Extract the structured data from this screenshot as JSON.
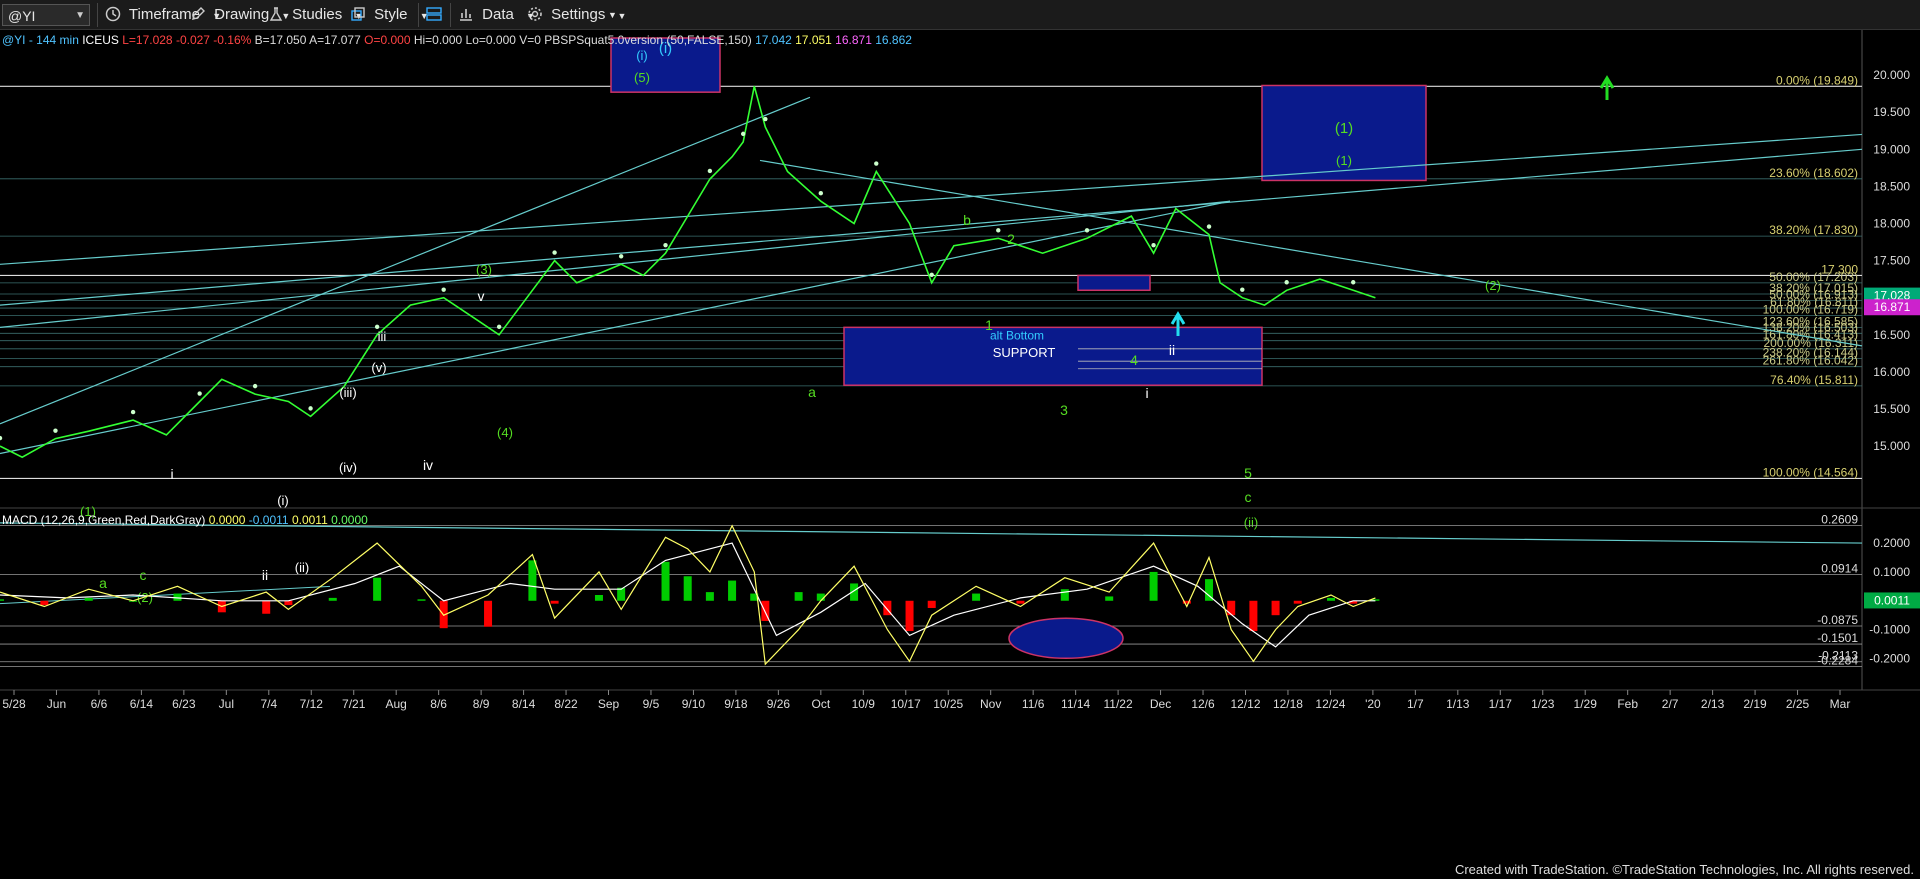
{
  "toolbar": {
    "symbol": "@YI",
    "timeframe": "Timeframe",
    "drawing": "Drawing",
    "studies": "Studies",
    "style": "Style",
    "data": "Data",
    "settings": "Settings"
  },
  "header_line": {
    "parts": [
      {
        "text": "@YI - 144 min",
        "color": "#4fc3ff"
      },
      {
        "text": "ICEUS",
        "color": "#ffffff"
      },
      {
        "text": "L=17.028",
        "color": "#ff4444"
      },
      {
        "text": "-0.027",
        "color": "#ff4444"
      },
      {
        "text": "-0.16%",
        "color": "#ff4444"
      },
      {
        "text": "B=17.050",
        "color": "#dddddd"
      },
      {
        "text": "A=17.077",
        "color": "#dddddd"
      },
      {
        "text": "O=0.000",
        "color": "#ff4444"
      },
      {
        "text": "Hi=0.000",
        "color": "#dddddd"
      },
      {
        "text": "Lo=0.000",
        "color": "#dddddd"
      },
      {
        "text": "V=0",
        "color": "#dddddd"
      },
      {
        "text": "PBSPSquat5.0version (50,FALSE,150)",
        "color": "#dddddd"
      },
      {
        "text": "17.042",
        "color": "#4fc3ff"
      },
      {
        "text": "17.051",
        "color": "#ffff66"
      },
      {
        "text": "16.871",
        "color": "#ff66ff"
      },
      {
        "text": "16.862",
        "color": "#4fc3ff"
      }
    ]
  },
  "macd_header": {
    "parts": [
      {
        "text": "MACD (12,26,9,Green,Red,DarkGray)",
        "color": "#ffffff"
      },
      {
        "text": "0.0000",
        "color": "#ffff66"
      },
      {
        "text": "-0.0011",
        "color": "#4fc3ff"
      },
      {
        "text": "0.0011",
        "color": "#ffff66"
      },
      {
        "text": "0.0000",
        "color": "#66ff66"
      }
    ]
  },
  "footer": "Created with TradeStation. ©TradeStation Technologies, Inc. All rights reserved.",
  "colors": {
    "background": "#000000",
    "price": "#33ff33",
    "trendline": "#66cccc",
    "box_fill": "#0a1a8c",
    "box_border": "#cc3366",
    "label_green": "#55dd22",
    "label_white": "#ffffff",
    "label_cyan": "#33ccff",
    "macd_fast": "#ffff66",
    "macd_slow": "#ffffff",
    "hist_up": "#00cc00",
    "hist_down": "#ff0000"
  },
  "chart_data": [
    {
      "type": "line",
      "title": "@YI - 144 min",
      "y_axis_ticks": [
        "20.000",
        "19.500",
        "19.000",
        "18.500",
        "18.000",
        "17.500",
        "17.000",
        "16.500",
        "16.000",
        "15.500",
        "15.000"
      ],
      "ylim": [
        14.3,
        20.5
      ],
      "x_axis_labels": [
        "5/28",
        "Jun",
        "6/6",
        "6/14",
        "6/23",
        "Jul",
        "7/4",
        "7/12",
        "7/21",
        "Aug",
        "8/6",
        "8/9",
        "8/14",
        "8/22",
        "Sep",
        "9/5",
        "9/10",
        "9/18",
        "9/26",
        "Oct",
        "10/9",
        "10/17",
        "10/25",
        "Nov",
        "11/6",
        "11/14",
        "11/22",
        "Dec",
        "12/6",
        "12/12",
        "12/18",
        "12/24",
        "'20",
        "1/7",
        "1/13",
        "1/17",
        "1/23",
        "1/29",
        "Feb",
        "2/7",
        "2/13",
        "2/19",
        "2/25",
        "Mar"
      ],
      "price_badges": [
        {
          "value": "17.028",
          "color": "#00aa77"
        },
        {
          "value": "16.871",
          "color": "#cc22cc"
        }
      ],
      "fib_levels": [
        {
          "label": "0.00% (19.849)",
          "value": 19.849
        },
        {
          "label": "23.60% (18.602)",
          "value": 18.602
        },
        {
          "label": "38.20% (17.830)",
          "value": 17.83
        },
        {
          "label": "17.300",
          "value": 17.3
        },
        {
          "label": "50.00% (17.203)",
          "value": 17.2
        },
        {
          "label": "38.20% (17.015)",
          "value": 17.05
        },
        {
          "label": "50.00% (16.913)",
          "value": 16.96
        },
        {
          "label": "61.80% (16.811)",
          "value": 16.86
        },
        {
          "label": "100.00% (16.719)",
          "value": 16.76
        },
        {
          "label": "123.60% (16.585)",
          "value": 16.6
        },
        {
          "label": "138.20% (16.503)",
          "value": 16.52
        },
        {
          "label": "161.80% (16.413)",
          "value": 16.42
        },
        {
          "label": "200.00% (16.311)",
          "value": 16.311
        },
        {
          "label": "238.20% (16.144)",
          "value": 16.18
        },
        {
          "label": "261.80% (16.042)",
          "value": 16.07
        },
        {
          "label": "76.40% (15.811)",
          "value": 15.811
        },
        {
          "label": "100.00% (14.564)",
          "value": 14.564
        }
      ],
      "boxes": [
        {
          "label": "(i)",
          "x0": 0.47,
          "x1": 0.53,
          "y0": 20.5,
          "y1": 19.77
        },
        {
          "label": "(1)",
          "x0": 1.0,
          "x1": 1.32,
          "y0": 19.86,
          "y1": 18.58
        },
        {
          "label": "alt Bottom",
          "x0": 0.68,
          "x1": 1.0,
          "y0": 16.6,
          "y1": 15.82
        },
        {
          "label": "",
          "x0": 0.83,
          "x1": 0.9,
          "y0": 17.3,
          "y1": 17.1
        }
      ],
      "box_labels": [
        "SUPPORT"
      ],
      "wave_labels": [
        {
          "text": "(1)",
          "color": "#55dd22"
        },
        {
          "text": "a",
          "color": "#55dd22"
        },
        {
          "text": "c",
          "color": "#55dd22"
        },
        {
          "text": "(2)",
          "color": "#55dd22"
        },
        {
          "text": "i",
          "color": "#ffffff"
        },
        {
          "text": "ii",
          "color": "#ffffff"
        },
        {
          "text": "(i)",
          "color": "#ffffff"
        },
        {
          "text": "(ii)",
          "color": "#ffffff"
        },
        {
          "text": "(iii)",
          "color": "#ffffff"
        },
        {
          "text": "(iv)",
          "color": "#ffffff"
        },
        {
          "text": "(v)",
          "color": "#ffffff"
        },
        {
          "text": "iii",
          "color": "#ffffff"
        },
        {
          "text": "iv",
          "color": "#ffffff"
        },
        {
          "text": "v",
          "color": "#ffffff"
        },
        {
          "text": "(3)",
          "color": "#55dd22"
        },
        {
          "text": "(4)",
          "color": "#55dd22"
        },
        {
          "text": "(5)",
          "color": "#55dd22"
        },
        {
          "text": "(i)",
          "color": "#33ccff"
        },
        {
          "text": "a",
          "color": "#55dd22"
        },
        {
          "text": "b",
          "color": "#55dd22"
        },
        {
          "text": "1",
          "color": "#55dd22"
        },
        {
          "text": "2",
          "color": "#55dd22"
        },
        {
          "text": "3",
          "color": "#55dd22"
        },
        {
          "text": "4",
          "color": "#55dd22"
        },
        {
          "text": "5",
          "color": "#55dd22"
        },
        {
          "text": "i",
          "color": "#ffffff"
        },
        {
          "text": "ii",
          "color": "#ffffff"
        },
        {
          "text": "c",
          "color": "#55dd22"
        },
        {
          "text": "(ii)",
          "color": "#55dd22"
        },
        {
          "text": "(1)",
          "color": "#55dd22"
        },
        {
          "text": "(2)",
          "color": "#55dd22"
        }
      ],
      "price_path": [
        [
          0,
          15.0
        ],
        [
          0.01,
          14.85
        ],
        [
          0.025,
          15.1
        ],
        [
          0.04,
          15.2
        ],
        [
          0.06,
          15.35
        ],
        [
          0.075,
          15.15
        ],
        [
          0.09,
          15.6
        ],
        [
          0.1,
          15.9
        ],
        [
          0.115,
          15.7
        ],
        [
          0.13,
          15.6
        ],
        [
          0.14,
          15.4
        ],
        [
          0.155,
          15.8
        ],
        [
          0.17,
          16.5
        ],
        [
          0.185,
          16.9
        ],
        [
          0.2,
          17.0
        ],
        [
          0.215,
          16.7
        ],
        [
          0.225,
          16.5
        ],
        [
          0.24,
          17.1
        ],
        [
          0.25,
          17.5
        ],
        [
          0.26,
          17.2
        ],
        [
          0.28,
          17.45
        ],
        [
          0.29,
          17.3
        ],
        [
          0.3,
          17.6
        ],
        [
          0.31,
          18.1
        ],
        [
          0.32,
          18.6
        ],
        [
          0.33,
          18.9
        ],
        [
          0.335,
          19.1
        ],
        [
          0.34,
          19.85
        ],
        [
          0.345,
          19.3
        ],
        [
          0.355,
          18.7
        ],
        [
          0.37,
          18.3
        ],
        [
          0.385,
          18.0
        ],
        [
          0.395,
          18.7
        ],
        [
          0.41,
          18.0
        ],
        [
          0.42,
          17.2
        ],
        [
          0.43,
          17.7
        ],
        [
          0.45,
          17.8
        ],
        [
          0.47,
          17.6
        ],
        [
          0.49,
          17.8
        ],
        [
          0.51,
          18.1
        ],
        [
          0.52,
          17.6
        ],
        [
          0.53,
          18.2
        ],
        [
          0.545,
          17.85
        ],
        [
          0.55,
          17.2
        ],
        [
          0.56,
          17.0
        ],
        [
          0.57,
          16.9
        ],
        [
          0.58,
          17.1
        ],
        [
          0.595,
          17.25
        ],
        [
          0.61,
          17.1
        ],
        [
          0.62,
          17.0
        ]
      ],
      "support_lines": [
        "16.311",
        "16.144",
        "16.042"
      ]
    },
    {
      "type": "line",
      "title": "MACD (12,26,9,Green,Red,DarkGray)",
      "y_axis_ticks": [
        "0.2000",
        "0.1000",
        "-0.1000",
        "-0.2000"
      ],
      "ylim": [
        -0.24,
        0.28
      ],
      "levels": [
        {
          "label": "0.2609",
          "value": 0.2609
        },
        {
          "label": "0.0914",
          "value": 0.0914
        },
        {
          "label": "-0.0875",
          "value": -0.0875
        },
        {
          "label": "-0.1501",
          "value": -0.1501
        },
        {
          "label": "-0.2113",
          "value": -0.2113
        },
        {
          "label": "-0.2284",
          "value": -0.2284
        }
      ],
      "value_badge": {
        "value": "0.0011",
        "color": "#00aa44"
      },
      "macd": [
        [
          0,
          0.03
        ],
        [
          0.02,
          -0.02
        ],
        [
          0.04,
          0.04
        ],
        [
          0.06,
          0.0
        ],
        [
          0.08,
          0.05
        ],
        [
          0.1,
          -0.02
        ],
        [
          0.12,
          0.03
        ],
        [
          0.13,
          -0.03
        ],
        [
          0.15,
          0.08
        ],
        [
          0.17,
          0.2
        ],
        [
          0.19,
          0.05
        ],
        [
          0.2,
          -0.05
        ],
        [
          0.22,
          0.02
        ],
        [
          0.24,
          0.16
        ],
        [
          0.25,
          -0.06
        ],
        [
          0.27,
          0.1
        ],
        [
          0.28,
          -0.03
        ],
        [
          0.3,
          0.22
        ],
        [
          0.31,
          0.18
        ],
        [
          0.32,
          0.1
        ],
        [
          0.33,
          0.26
        ],
        [
          0.34,
          0.1
        ],
        [
          0.345,
          -0.22
        ],
        [
          0.36,
          -0.1
        ],
        [
          0.37,
          0.0
        ],
        [
          0.385,
          0.12
        ],
        [
          0.4,
          -0.1
        ],
        [
          0.41,
          -0.21
        ],
        [
          0.42,
          -0.05
        ],
        [
          0.44,
          0.05
        ],
        [
          0.46,
          -0.02
        ],
        [
          0.48,
          0.08
        ],
        [
          0.5,
          0.03
        ],
        [
          0.52,
          0.2
        ],
        [
          0.535,
          -0.02
        ],
        [
          0.545,
          0.15
        ],
        [
          0.555,
          -0.1
        ],
        [
          0.565,
          -0.21
        ],
        [
          0.575,
          -0.1
        ],
        [
          0.585,
          -0.02
        ],
        [
          0.6,
          0.02
        ],
        [
          0.61,
          -0.02
        ],
        [
          0.62,
          0.01
        ]
      ],
      "signal": [
        [
          0,
          0.02
        ],
        [
          0.03,
          0.01
        ],
        [
          0.06,
          0.02
        ],
        [
          0.1,
          0.0
        ],
        [
          0.13,
          0.0
        ],
        [
          0.16,
          0.06
        ],
        [
          0.18,
          0.12
        ],
        [
          0.2,
          0.0
        ],
        [
          0.23,
          0.06
        ],
        [
          0.25,
          0.04
        ],
        [
          0.28,
          0.04
        ],
        [
          0.3,
          0.14
        ],
        [
          0.33,
          0.2
        ],
        [
          0.35,
          -0.12
        ],
        [
          0.37,
          -0.04
        ],
        [
          0.39,
          0.06
        ],
        [
          0.41,
          -0.12
        ],
        [
          0.43,
          -0.05
        ],
        [
          0.46,
          0.01
        ],
        [
          0.49,
          0.04
        ],
        [
          0.52,
          0.12
        ],
        [
          0.54,
          0.05
        ],
        [
          0.56,
          -0.08
        ],
        [
          0.575,
          -0.16
        ],
        [
          0.59,
          -0.05
        ],
        [
          0.61,
          0.0
        ],
        [
          0.62,
          0.0
        ]
      ]
    }
  ]
}
